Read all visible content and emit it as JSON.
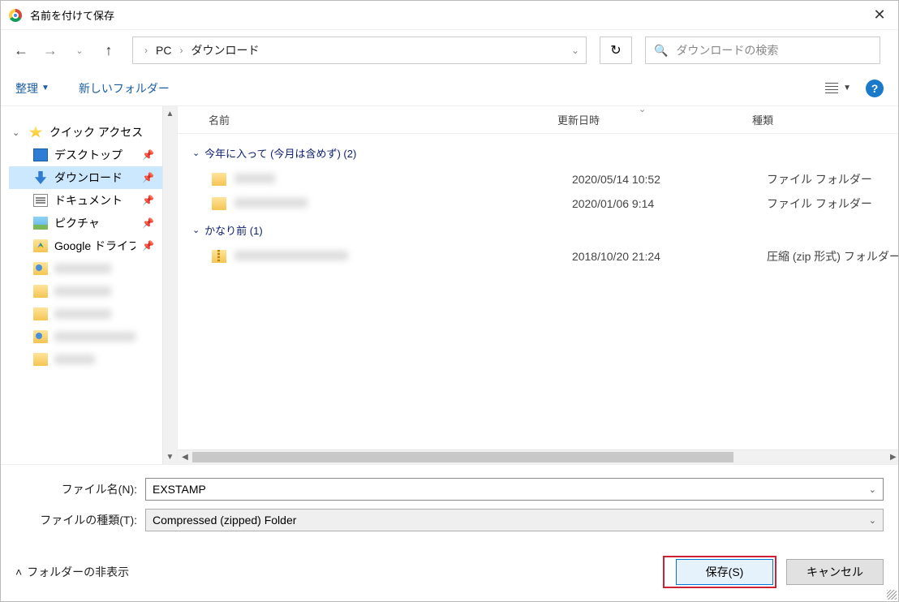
{
  "titlebar": {
    "title": "名前を付けて保存"
  },
  "nav": {
    "crumb_root": "PC",
    "crumb_current": "ダウンロード",
    "search_placeholder": "ダウンロードの検索"
  },
  "toolbar": {
    "organize": "整理",
    "newfolder": "新しいフォルダー"
  },
  "sidebar": {
    "quick_access": "クイック アクセス",
    "items": [
      {
        "label": "デスクトップ"
      },
      {
        "label": "ダウンロード"
      },
      {
        "label": "ドキュメント"
      },
      {
        "label": "ピクチャ"
      },
      {
        "label": "Google ドライブ"
      }
    ]
  },
  "columns": {
    "name": "名前",
    "date": "更新日時",
    "type": "種類"
  },
  "groups": [
    {
      "label": "今年に入って (今月は含めず) (2)",
      "files": [
        {
          "name": "",
          "date": "2020/05/14 10:52",
          "type": "ファイル フォルダー",
          "icon": "folder"
        },
        {
          "name": "",
          "date": "2020/01/06 9:14",
          "type": "ファイル フォルダー",
          "icon": "folder"
        }
      ]
    },
    {
      "label": "かなり前 (1)",
      "files": [
        {
          "name": "",
          "date": "2018/10/20 21:24",
          "type": "圧縮 (zip 形式) フォルダー",
          "icon": "zip"
        }
      ]
    }
  ],
  "form": {
    "filename_label": "ファイル名(N):",
    "filename_value": "EXSTAMP",
    "filetype_label": "ファイルの種類(T):",
    "filetype_value": "Compressed (zipped) Folder"
  },
  "footer": {
    "hide_folders": "フォルダーの非表示",
    "save": "保存(S)",
    "cancel": "キャンセル"
  }
}
